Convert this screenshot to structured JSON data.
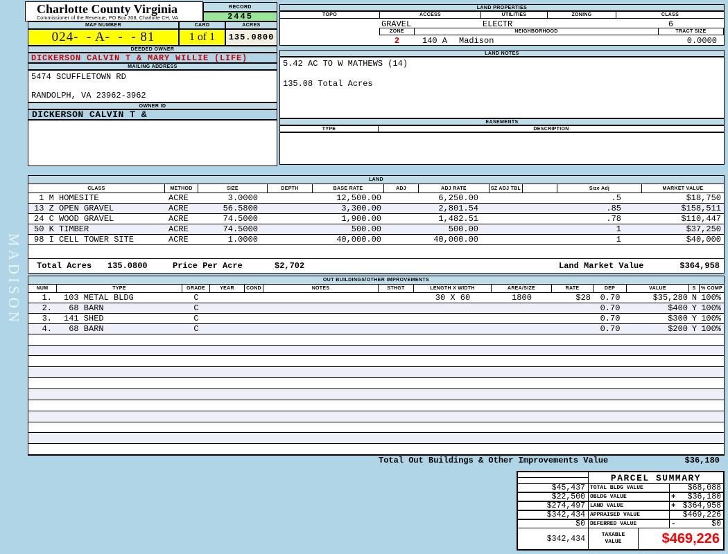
{
  "colors": {
    "page-bg": "#AFD5E6",
    "band-bg": "#BEDDE9",
    "record-green": "#99E699",
    "acres-cream": "#F1F0E1",
    "highlight-yellow": "#FFFF00",
    "row-tint": "#EEF0F9",
    "owner-red": "#CC0000",
    "value-red": "#FF0000"
  },
  "page": {
    "watermark": "MADISON"
  },
  "header": {
    "title": "Charlotte County Virginia",
    "subtitle": "Commissioner of the Revenue, PO Box 308, Charlotte CH, VA",
    "record_label": "RECORD",
    "record_value": "2445",
    "map_number_label": "MAP NUMBER",
    "map_number_value": "024-  - A-  -  - 81",
    "card_label": "CARD",
    "card_value": "1 of 1",
    "acres_label": "ACRES",
    "acres_value": "135.0800",
    "deeded_owner_label": "DEEDED OWNER",
    "deeded_owner": "DICKERSON CALVIN T & MARY WILLIE (LIFE)",
    "mailing_address_label": "MAILING ADDRESS",
    "address_line1": "5474 SCUFFLETOWN RD",
    "address_line2": "RANDOLPH, VA 23962-3962",
    "owner_id_label": "OWNER ID",
    "owner_id": "DICKERSON CALVIN T &"
  },
  "land_properties": {
    "title": "LAND PROPERTIES",
    "columns": [
      "TOPO",
      "ACCESS",
      "UTILITIES",
      "ZONING",
      "CLASS"
    ],
    "access_value": "GRAVEL",
    "utilities_value": "ELECTR",
    "class_value": "6",
    "zone_label": "ZONE",
    "zone_value": "2",
    "neighborhood_label": "NEIGHBORHOOD",
    "neighborhood_code": "140 A",
    "neighborhood_name": "Madison",
    "tract_size_label": "TRACT SIZE",
    "tract_size_value": "0.0000"
  },
  "land_notes": {
    "title": "LAND NOTES",
    "line1": "5.42 AC TO W MATHEWS (14)",
    "line2": "135.08 Total Acres"
  },
  "easements": {
    "title": "EASEMENTS",
    "type_label": "TYPE",
    "description_label": "DESCRIPTION"
  },
  "land": {
    "title": "LAND",
    "columns": [
      "CLASS",
      "METHOD",
      "SIZE",
      "DEPTH",
      "BASE RATE",
      "ADJ",
      "ADJ RATE",
      "SZ ADJ TBL",
      "",
      "Size Adj",
      "MARKET VALUE"
    ],
    "rows": [
      {
        "class": " 1 M HOMESITE",
        "method": "ACRE",
        "size": "3.0000",
        "base_rate": "12,500.00",
        "adj_rate": "6,250.00",
        "size_adj": ".5",
        "market_value": "$18,750"
      },
      {
        "class": "13 Z OPEN GRAVEL",
        "method": "ACRE",
        "size": "56.5800",
        "base_rate": "3,300.00",
        "adj_rate": "2,801.54",
        "size_adj": ".85",
        "market_value": "$158,511"
      },
      {
        "class": "24 C WOOD GRAVEL",
        "method": "ACRE",
        "size": "74.5000",
        "base_rate": "1,900.00",
        "adj_rate": "1,482.51",
        "size_adj": ".78",
        "market_value": "$110,447"
      },
      {
        "class": "50 K TIMBER",
        "method": "ACRE",
        "size": "74.5000",
        "base_rate": "500.00",
        "adj_rate": "500.00",
        "size_adj": "1",
        "market_value": "$37,250"
      },
      {
        "class": "98 I CELL TOWER SITE",
        "method": "ACRE",
        "size": "1.0000",
        "base_rate": "40,000.00",
        "adj_rate": "40,000.00",
        "size_adj": "1",
        "market_value": "$40,000"
      }
    ],
    "total_acres_label": "Total Acres",
    "total_acres": "135.0800",
    "price_per_acre_label": "Price Per Acre",
    "price_per_acre": "$2,702",
    "market_value_label": "Land Market Value",
    "market_value_total": "$364,958"
  },
  "outbuildings": {
    "title": "OUT BUILDINGS/OTHER IMPROVEMENTS",
    "columns": [
      "NUM",
      "TYPE",
      "GRADE",
      "YEAR",
      "COND",
      "NOTES",
      "STHGT",
      "LENGTH X WIDTH",
      "AREA/SIZE",
      "RATE",
      "DEP",
      "VALUE",
      "S",
      "% COMP"
    ],
    "rows": [
      {
        "num": "1.",
        "type": "103 METAL BLDG",
        "grade": "C",
        "length_width": "30 X 60",
        "area_size": "1800",
        "rate": "$28",
        "dep": "0.70",
        "value": "$35,280",
        "s": "N",
        "pct_comp": "100%"
      },
      {
        "num": "2.",
        "type": " 68 BARN",
        "grade": "C",
        "length_width": "",
        "area_size": "",
        "rate": "",
        "dep": "0.70",
        "value": "$400",
        "s": "Y",
        "pct_comp": "100%"
      },
      {
        "num": "3.",
        "type": "141 SHED",
        "grade": "C",
        "length_width": "",
        "area_size": "",
        "rate": "",
        "dep": "0.70",
        "value": "$300",
        "s": "Y",
        "pct_comp": "100%"
      },
      {
        "num": "4.",
        "type": " 68 BARN",
        "grade": "C",
        "length_width": "",
        "area_size": "",
        "rate": "",
        "dep": "0.70",
        "value": "$200",
        "s": "Y",
        "pct_comp": "100%"
      }
    ],
    "total_label": "Total Out Buildings & Other Improvements Value",
    "total_value": "$36,180"
  },
  "parcel_summary": {
    "title": "PARCEL SUMMARY",
    "rows": [
      {
        "left": "$45,437",
        "label": "TOTAL BLDG VALUE",
        "op": "",
        "value": "$68,088"
      },
      {
        "left": "$22,500",
        "label": "OBLDG VALUE",
        "op": "+",
        "value": "$36,180"
      },
      {
        "left": "$274,497",
        "label": "LAND VALUE",
        "op": "+",
        "value": "$364,958"
      },
      {
        "left": "$342,434",
        "label": "APPRAISED VALUE",
        "op": "",
        "value": "$469,226"
      },
      {
        "left": "$0",
        "label": "DEFERRED VALUE",
        "op": "-",
        "value": "$0"
      }
    ],
    "taxable_left": "$342,434",
    "taxable_label": "TAXABLE VALUE",
    "taxable_value": "$469,226"
  }
}
